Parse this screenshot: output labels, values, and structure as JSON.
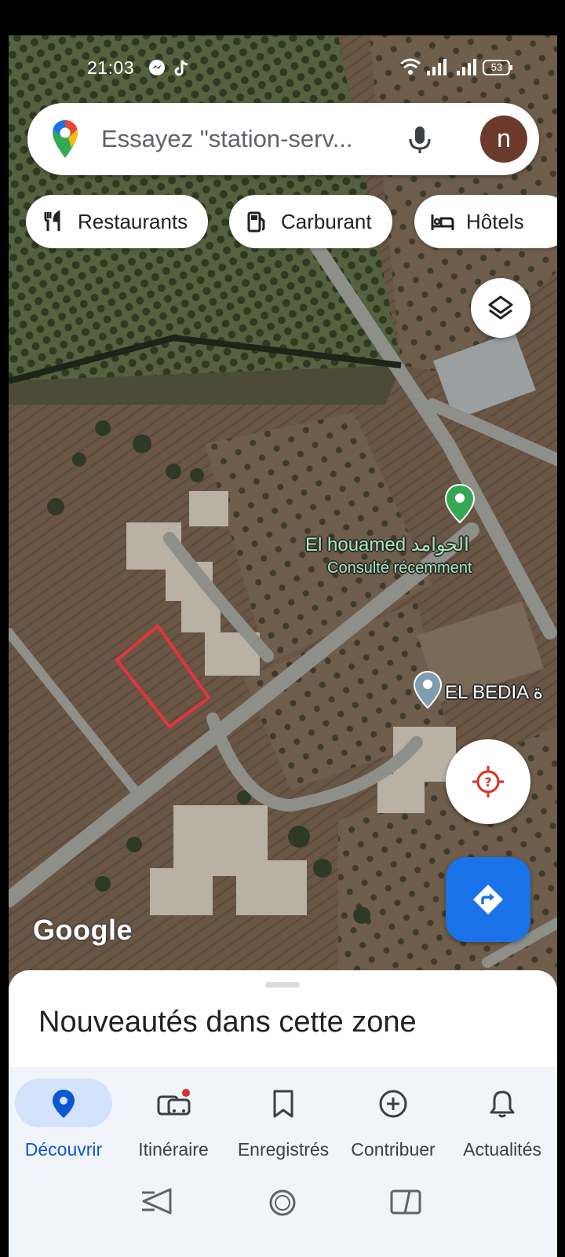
{
  "status_bar": {
    "time": "21:03",
    "battery": "53",
    "icons": [
      "messenger-icon",
      "tiktok-icon",
      "wifi-icon",
      "signal-icon",
      "signal-icon",
      "battery-icon"
    ]
  },
  "search": {
    "placeholder": "Essayez \"station-serv...",
    "avatar_letter": "n",
    "mic_icon": "microphone-icon"
  },
  "chips": [
    {
      "label": "Restaurants",
      "icon": "fork-knife-icon"
    },
    {
      "label": "Carburant",
      "icon": "fuel-pump-icon"
    },
    {
      "label": "Hôtels",
      "icon": "bed-icon"
    }
  ],
  "map": {
    "pois": [
      {
        "name": "El houamed الحوامد",
        "subtitle": "Consulté récemment",
        "pin_color": "#34a853"
      },
      {
        "name": "EL BEDIA ة",
        "pin_color": "#8ab4c8"
      }
    ],
    "watermark": "Google",
    "highlight_color": "#e8323c"
  },
  "fabs": {
    "layers_icon": "layers-icon",
    "location_icon": "location-unknown-icon",
    "directions_icon": "directions-icon"
  },
  "bottom_sheet": {
    "title": "Nouveautés dans cette zone"
  },
  "bottom_nav": {
    "items": [
      {
        "label": "Découvrir",
        "icon": "location-pin-icon",
        "active": true
      },
      {
        "label": "Itinéraire",
        "icon": "commute-icon",
        "active": false,
        "badge": true
      },
      {
        "label": "Enregistrés",
        "icon": "bookmark-icon",
        "active": false
      },
      {
        "label": "Contribuer",
        "icon": "add-circle-icon",
        "active": false
      },
      {
        "label": "Actualités",
        "icon": "bell-icon",
        "active": false
      }
    ]
  },
  "colors": {
    "accent": "#1a73e8",
    "active_nav": "#0b57d0",
    "active_pill": "#d3e3fd"
  }
}
